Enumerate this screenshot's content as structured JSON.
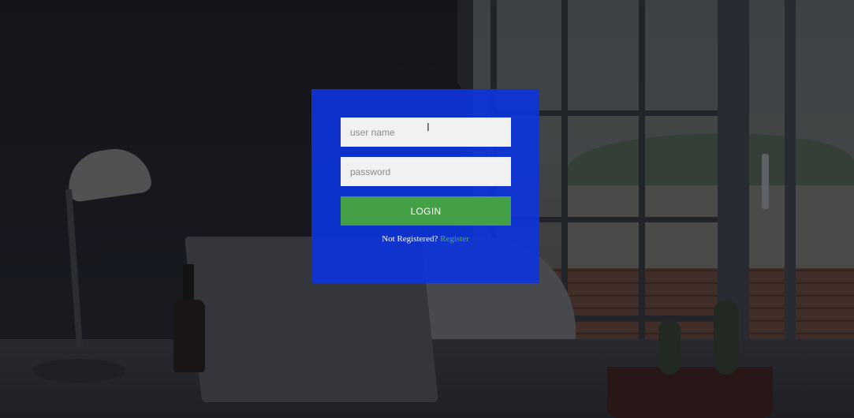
{
  "login": {
    "username_placeholder": "user name",
    "password_placeholder": "password",
    "login_label": "LOGIN",
    "not_registered_text": "Not Registered?",
    "register_link": "Register"
  },
  "colors": {
    "card": "#0c34de",
    "button": "#43a047",
    "link": "#4caf50"
  }
}
